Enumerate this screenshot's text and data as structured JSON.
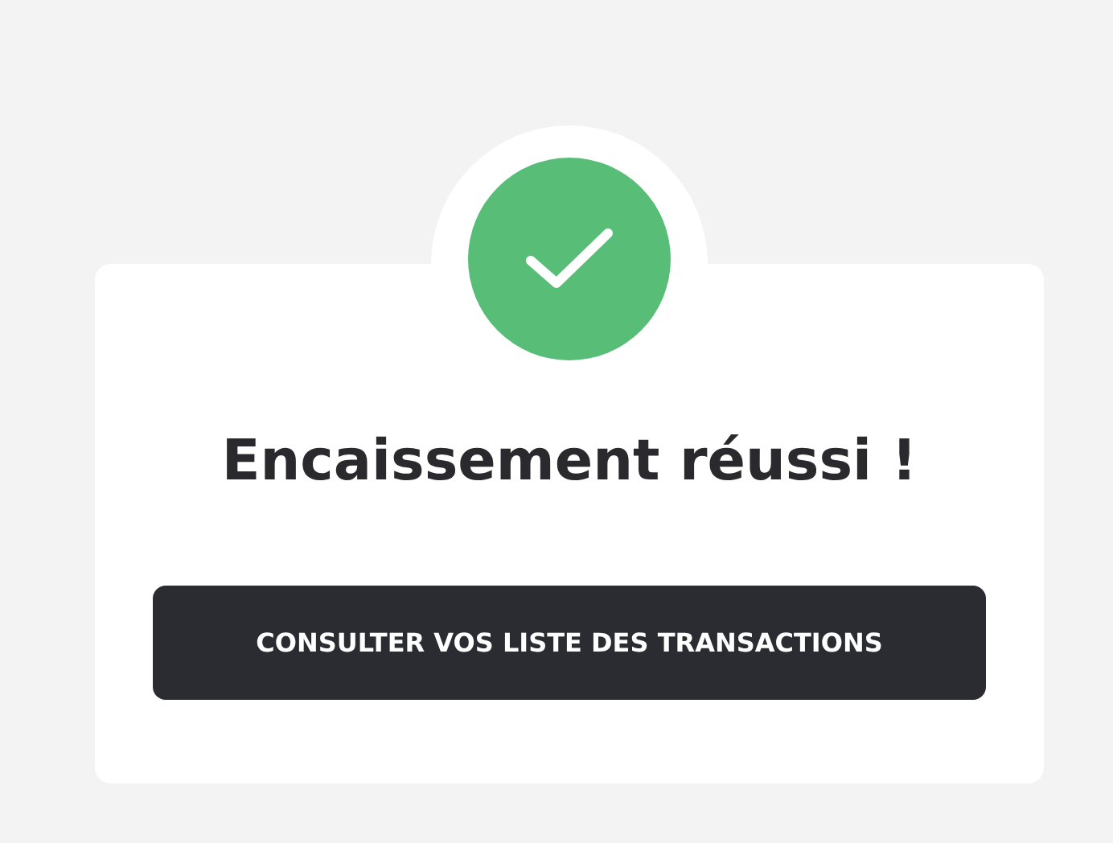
{
  "status": {
    "kind": "success"
  },
  "title": "Encaissement réussi !",
  "button": {
    "label": "CONSULTER VOS LISTE DES TRANSACTIONS"
  }
}
